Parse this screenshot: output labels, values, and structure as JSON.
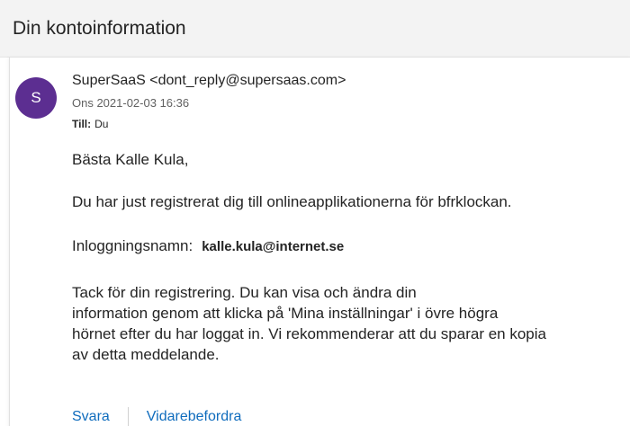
{
  "email": {
    "subject": "Din kontoinformation",
    "avatar_initial": "S",
    "sender": "SuperSaaS <dont_reply@supersaas.com>",
    "date": "Ons 2021-02-03 16:36",
    "to_label": "Till:",
    "to_value": "Du",
    "body": {
      "greeting": "Bästa Kalle Kula,",
      "line1": "Du har just registrerat dig till onlineapplikationerna för bfrklockan.",
      "login_label": "Inloggningsnamn:",
      "login_value": "kalle.kula@internet.se",
      "paragraph_lines": [
        "Tack för din registrering. Du kan visa och ändra din",
        "information genom att klicka på 'Mina inställningar' i övre högra",
        "hörnet efter du har loggat in. Vi rekommenderar att du sparar en kopia",
        "av detta meddelande."
      ]
    },
    "actions": {
      "reply": "Svara",
      "forward": "Vidarebefordra"
    }
  },
  "colors": {
    "avatar": "#5c2e91",
    "link": "#0f6cbd"
  }
}
